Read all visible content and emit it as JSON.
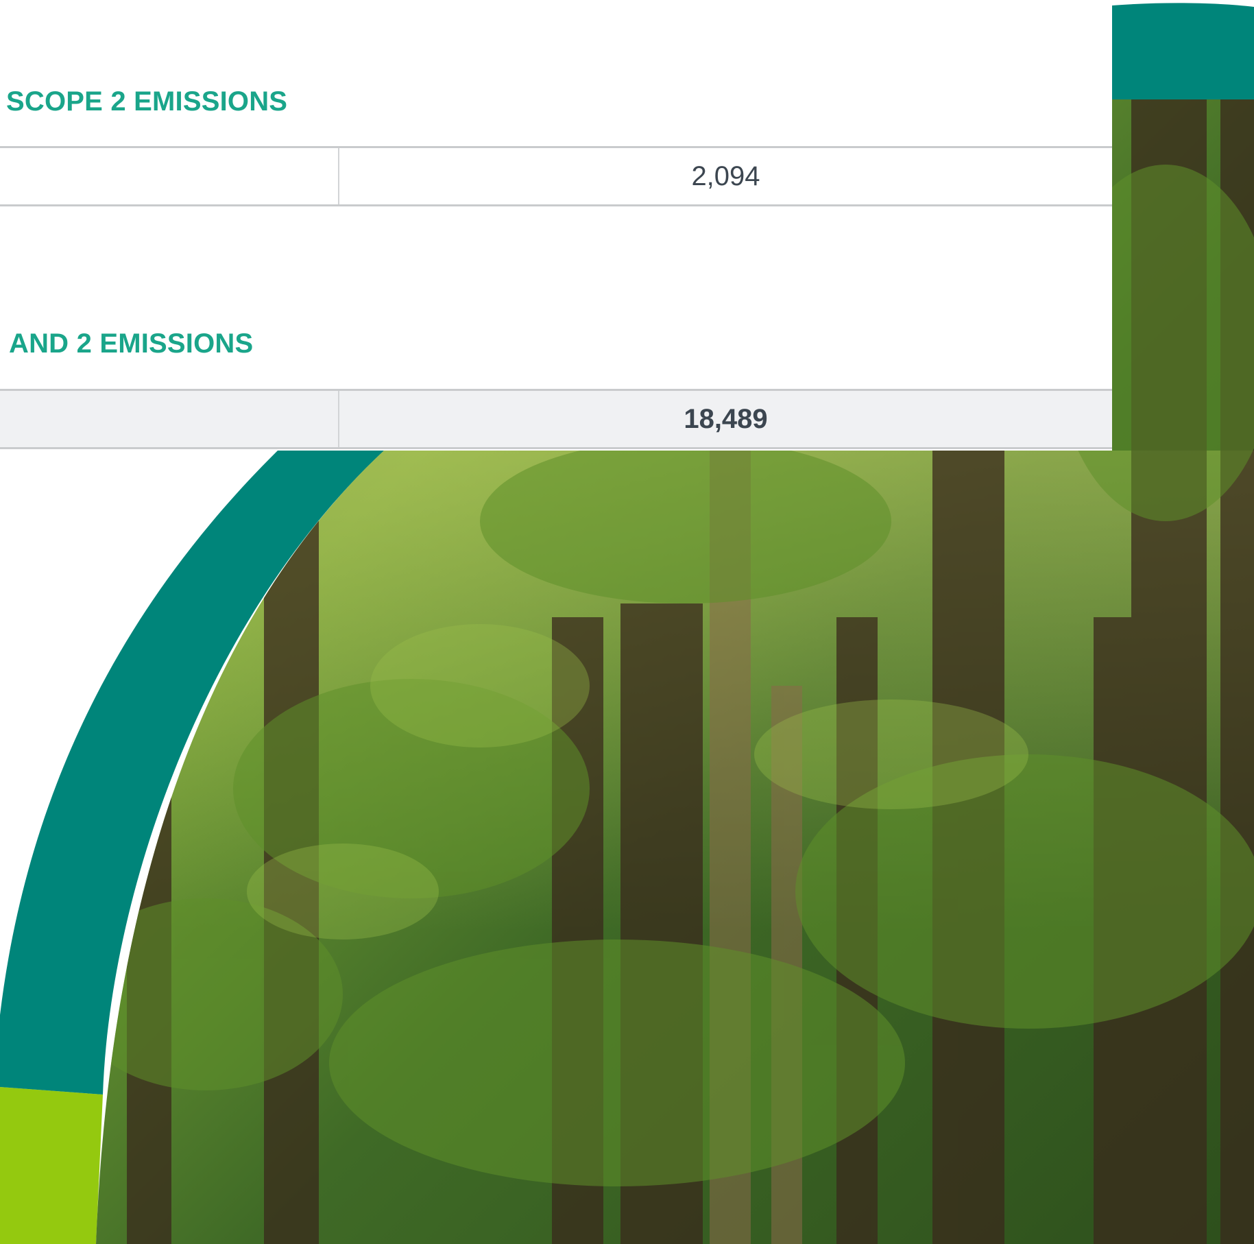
{
  "theme": {
    "accent_teal": "#00857a",
    "accent_lime": "#94c90f",
    "heading_green": "#1aa58a",
    "total_row_bg": "#f0f1f3"
  },
  "sections": [
    {
      "heading": "SCOPE 2 EMISSIONS",
      "value": "2,094"
    },
    {
      "heading": "AND 2 EMISSIONS",
      "value": "18,489"
    }
  ],
  "background_image": {
    "subject": "forest-photo"
  }
}
